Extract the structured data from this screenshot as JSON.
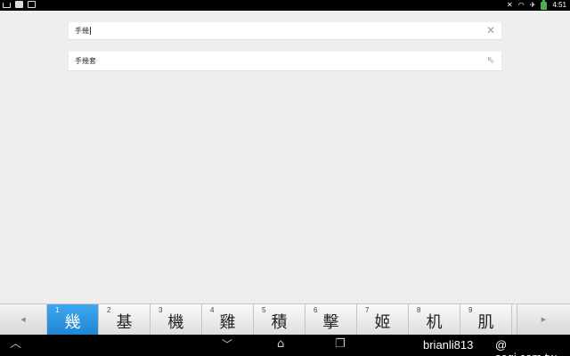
{
  "status_bar": {
    "time": "4:51"
  },
  "search": {
    "value": "手幾",
    "clear_icon": "close-icon"
  },
  "suggestions": [
    {
      "text": "手幾套",
      "icon": "arrow-up-left-icon"
    }
  ],
  "candidate_bar": {
    "selected_index": 0,
    "items": [
      {
        "num": "1",
        "char": "幾"
      },
      {
        "num": "2",
        "char": "基"
      },
      {
        "num": "3",
        "char": "機"
      },
      {
        "num": "4",
        "char": "雞"
      },
      {
        "num": "5",
        "char": "積"
      },
      {
        "num": "6",
        "char": "擊"
      },
      {
        "num": "7",
        "char": "姬"
      },
      {
        "num": "8",
        "char": "机"
      },
      {
        "num": "9",
        "char": "肌"
      }
    ]
  },
  "watermark": {
    "user": "brianli813",
    "site": "@ sogi.com.tw"
  },
  "colors": {
    "selected_candidate": "#2b97e3",
    "battery": "#4caf50"
  }
}
